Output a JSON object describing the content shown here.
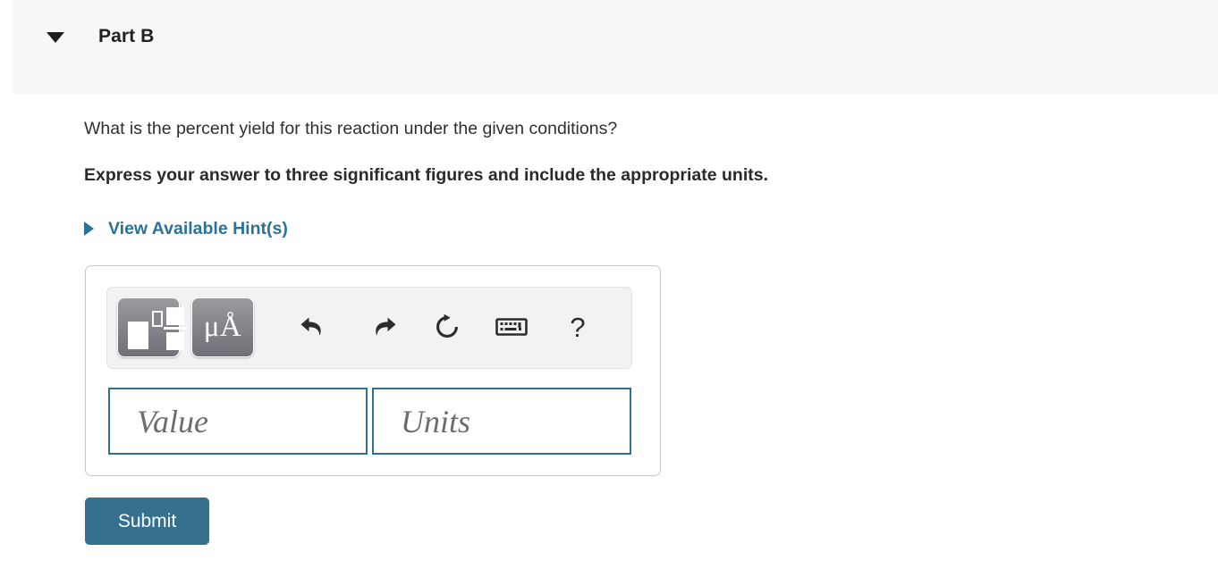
{
  "part": {
    "title": "Part B",
    "toggle_icon": "caret-down-icon",
    "collapsed": false
  },
  "question": {
    "prompt": "What is the percent yield for this reaction under the given conditions?",
    "instruction": "Express your answer to three significant figures and include the appropriate units."
  },
  "hints": {
    "label": "View Available Hint(s)",
    "toggle_icon": "caret-right-icon",
    "color": "#2b7296"
  },
  "answer_panel": {
    "toolbar": {
      "buttons": [
        {
          "name": "templates-button",
          "icon": "math-templates-icon",
          "label": ""
        },
        {
          "name": "units-button",
          "icon": "micro-angstrom-icon",
          "label": "μÅ"
        },
        {
          "name": "undo-button",
          "icon": "undo-icon",
          "label": ""
        },
        {
          "name": "redo-button",
          "icon": "redo-icon",
          "label": ""
        },
        {
          "name": "reset-button",
          "icon": "reset-icon",
          "label": ""
        },
        {
          "name": "keyboard-button",
          "icon": "keyboard-icon",
          "label": ""
        },
        {
          "name": "help-button",
          "icon": "question-mark-icon",
          "label": "?"
        }
      ]
    },
    "fields": [
      {
        "name": "value-input",
        "placeholder": "Value",
        "value": ""
      },
      {
        "name": "units-input",
        "placeholder": "Units",
        "value": ""
      }
    ],
    "border_color": "#31708f"
  },
  "submit": {
    "label": "Submit",
    "color": "#35708f"
  }
}
